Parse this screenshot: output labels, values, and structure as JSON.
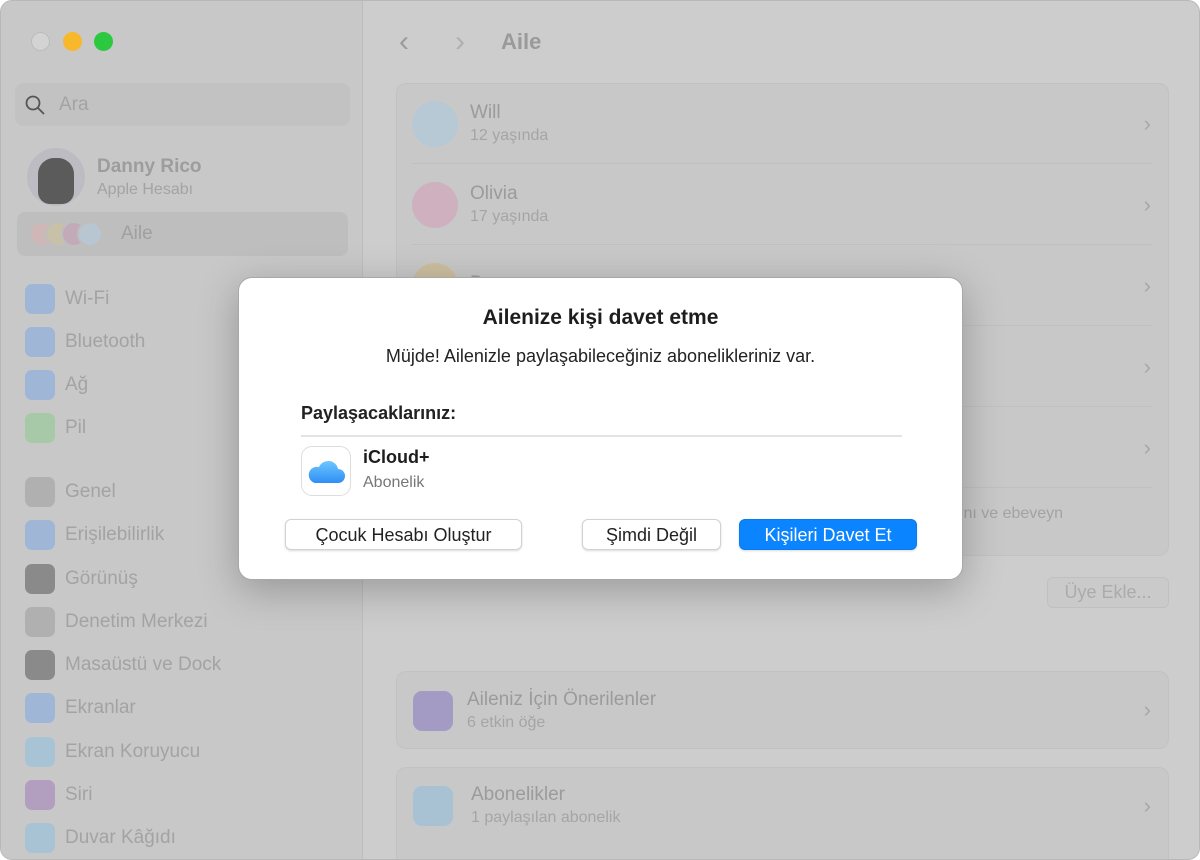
{
  "window": {
    "traffic_lights": {
      "close": "#d3d3d3",
      "minimize": "#f8b82c",
      "zoom": "#2bc840"
    }
  },
  "sidebar": {
    "search_placeholder": "Ara",
    "account": {
      "name": "Danny Rico",
      "subtitle": "Apple Hesabı"
    },
    "family_label": "Aile",
    "items": [
      {
        "label": "Wi-Fi",
        "icon": "wifi-icon",
        "color": "#9fb6d6"
      },
      {
        "label": "Bluetooth",
        "icon": "bluetooth-icon",
        "color": "#9fb6d6"
      },
      {
        "label": "Ağ",
        "icon": "globe-icon",
        "color": "#9fb6d6"
      },
      {
        "label": "Pil",
        "icon": "battery-icon",
        "color": "#a7c9a7"
      },
      {
        "label": "Genel",
        "icon": "gear-icon",
        "color": "#b0b0b0"
      },
      {
        "label": "Erişilebilirlik",
        "icon": "accessibility-icon",
        "color": "#9fb6d6"
      },
      {
        "label": "Görünüş",
        "icon": "appearance-icon",
        "color": "#8a8a8a"
      },
      {
        "label": "Denetim Merkezi",
        "icon": "control-center-icon",
        "color": "#b0b0b0"
      },
      {
        "label": "Masaüstü ve Dock",
        "icon": "dock-icon",
        "color": "#8a8a8a"
      },
      {
        "label": "Ekranlar",
        "icon": "sun-icon",
        "color": "#9fb6d6"
      },
      {
        "label": "Ekran Koruyucu",
        "icon": "screensaver-icon",
        "color": "#a8c4d4"
      },
      {
        "label": "Siri",
        "icon": "siri-icon",
        "color": "#b29fc0"
      },
      {
        "label": "Duvar Kâğıdı",
        "icon": "wallpaper-icon",
        "color": "#a8c4d4"
      }
    ]
  },
  "header": {
    "title": "Aile",
    "back": "‹",
    "forward": "›"
  },
  "members": [
    {
      "name": "Will",
      "subtitle": "12 yaşında",
      "color": "#b7c9d4"
    },
    {
      "name": "Olivia",
      "subtitle": "17 yaşında",
      "color": "#cfb0bf"
    },
    {
      "name": "Dawn",
      "subtitle": "",
      "color": "#cdbf9f"
    },
    {
      "name": "",
      "subtitle": "",
      "color": ""
    },
    {
      "name": "",
      "subtitle": "",
      "color": ""
    }
  ],
  "partial_text": "ını ve ebeveyn",
  "add_member_button": "Üye Ekle...",
  "suggestions": {
    "title": "Aileniz İçin Önerilenler",
    "subtitle": "6 etkin öğe"
  },
  "subscriptions": {
    "title": "Abonelikler",
    "subtitle": "1 paylaşılan abonelik"
  },
  "dialog": {
    "title": "Ailenize kişi davet etme",
    "message": "Müjde! Ailenizle paylaşabileceğiniz abonelikleriniz var.",
    "share_label": "Paylaşacaklarınız:",
    "item": {
      "name": "iCloud+",
      "subtitle": "Abonelik",
      "icon": "icloud-icon"
    },
    "buttons": {
      "create_child": "Çocuk Hesabı Oluştur",
      "not_now": "Şimdi Değil",
      "invite": "Kişileri Davet Et"
    },
    "accent": "#0a84ff"
  }
}
